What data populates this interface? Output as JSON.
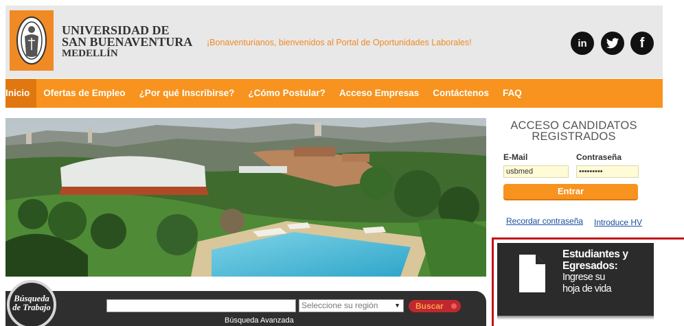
{
  "header": {
    "university_name": [
      "UNIVERSIDAD DE",
      "SAN BUENAVENTURA",
      "MEDELLÍN"
    ],
    "welcome": "¡Bonaventurianos, bienvenidos al Portal de Oportunidades Laborales!",
    "social": [
      {
        "icon": "linkedin-icon",
        "label": "in"
      },
      {
        "icon": "twitter-icon",
        "label": "t"
      },
      {
        "icon": "facebook-icon",
        "label": "f"
      }
    ]
  },
  "nav": {
    "items": [
      "Inicio",
      "Ofertas de Empleo",
      "¿Por qué Inscribirse?",
      "¿Cómo Postular?",
      "Acceso Empresas",
      "Contáctenos",
      "FAQ"
    ],
    "active": "Inicio"
  },
  "login": {
    "title_line1": "ACCESO CANDIDATOS",
    "title_line2": "REGISTRADOS",
    "email_label": "E-Mail",
    "password_label": "Contraseña",
    "email_value": "usbmed",
    "password_value": "•••••••••",
    "submit_label": "Entrar",
    "forgot_link": "Recordar contraseña",
    "cv_link": "Introduce HV"
  },
  "cv_banner": {
    "line1": "Estudiantes y",
    "line2": "Egresados:",
    "line3": "Ingrese su",
    "line4": "hoja de vida"
  },
  "search": {
    "badge_line1": "Búsqueda",
    "badge_line2": "de Trabajo",
    "region_placeholder": "Seleccione su región",
    "button_label": "Buscar",
    "advanced_link": "Búsqueda Avanzada"
  },
  "colors": {
    "brand_orange": "#f7931e",
    "nav_active": "#e07710",
    "dark": "#2f2f2f",
    "search_button": "#c0282e",
    "banner_border": "#c0101a",
    "link_blue": "#1a4fa0"
  }
}
